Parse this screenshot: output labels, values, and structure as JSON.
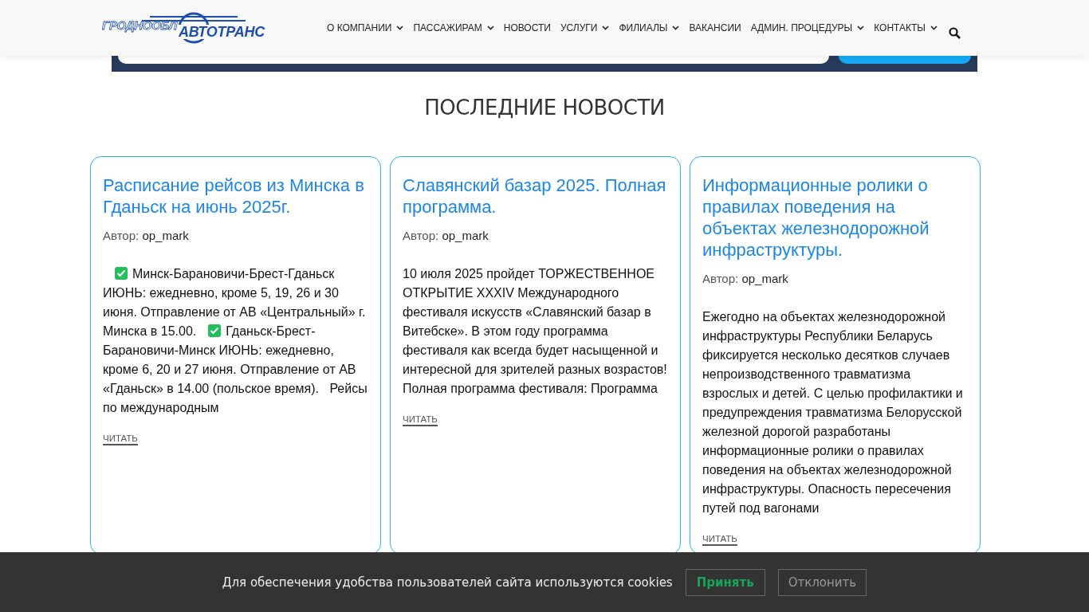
{
  "header": {
    "logo": {
      "part_1": "ГРОДНООБЛ",
      "part_2": "АВТОТРАНС"
    },
    "nav": [
      {
        "label": "О КОМПАНИИ",
        "dropdown": true
      },
      {
        "label": "ПАССАЖИРАМ",
        "dropdown": true
      },
      {
        "label": "НОВОСТИ",
        "dropdown": false
      },
      {
        "label": "УСЛУГИ",
        "dropdown": true
      },
      {
        "label": "ФИЛИАЛЫ",
        "dropdown": true
      },
      {
        "label": "ВАКАНСИИ",
        "dropdown": false
      },
      {
        "label": "АДМИН. ПРОЦЕДУРЫ",
        "dropdown": true
      },
      {
        "label": "КОНТАКТЫ",
        "dropdown": true
      }
    ]
  },
  "section_title": "ПОСЛЕДНИЕ НОВОСТИ",
  "news": [
    {
      "title": "Расписание рейсов из Минска в Гданьск на июнь 2025г.",
      "author_label": "Автор:",
      "author": "op_mark",
      "excerpt": [
        {
          "kind": "icon"
        },
        {
          "kind": "text",
          "text": "Минск-Барановичи-Брест-Гданьск ИЮНЬ: ежедневно, кроме 5, 19, 26 и 30 июня. Отправление от АВ «Центральный» г. Минска в 15.00."
        },
        {
          "kind": "icon"
        },
        {
          "kind": "text",
          "text": "Гданьск-Брест-Барановичи-Минск ИЮНЬ: ежедневно, кроме 6, 20 и 27 июня. Отправление от АВ «Гданьск» в 14.00 (польское время).   Рейсы по международным"
        }
      ],
      "read": "ЧИТАТЬ"
    },
    {
      "title": "Славянский базар 2025. Полная программа.",
      "author_label": "Автор:",
      "author": "op_mark",
      "excerpt": [
        {
          "kind": "text",
          "text": "10 июля 2025 пройдет ТОРЖЕСТВЕННОЕ ОТКРЫТИЕ XXXIV Международного фестиваля искусств «Славянский базар в Витебске». В этом году программа фестиваля как всегда будет насыщенной и интересной для зрителей разных возрастов! Полная программа фестиваля: Программа"
        }
      ],
      "read": "ЧИТАТЬ"
    },
    {
      "title": "Информационные ролики о правилах поведения на объектах железнодорожной инфраструктуры.",
      "author_label": "Автор:",
      "author": "op_mark",
      "excerpt": [
        {
          "kind": "text",
          "text": "Ежегодно на объектах железнодорожной инфраструктуры Республики Беларусь фиксируется несколько десятков случаев непроизводственного травматизма взрослых и детей. С целью профилактики и предупреждения травматизма Белорусской железной дорогой разработаны информационные ролики о правилах поведения на объектах железнодорожной инфраструктуры. Опасность пересечения путей под вагонами"
        }
      ],
      "read": "ЧИТАТЬ"
    }
  ],
  "cookie_bar": {
    "message": "Для обеспечения удобства пользователей сайта используются cookies",
    "accept": "Принять",
    "decline": "Отклонить"
  }
}
